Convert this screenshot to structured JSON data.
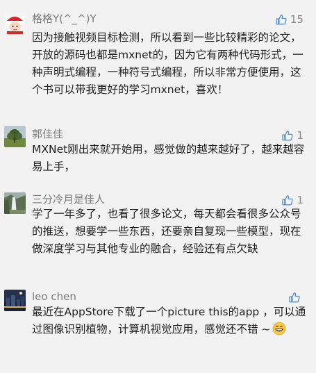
{
  "comments": [
    {
      "name": "格格Y(^_^)Y",
      "likes": "15",
      "avatar_icon": "christmas-girl-avatar",
      "text": "因为接触视频目标检测，所以看到一些比较精彩的论文，开放的源码也都是mxnet的，因为它有两种代码形式，一种声明式编程，一种符号式编程，所以非常方便使用，这个书可以带我更好的学习mxnet，喜欢！"
    },
    {
      "name": "郭佳佳",
      "likes": "1",
      "avatar_icon": "tree-landscape-avatar",
      "text": "MXNet刚出来就开始用，感觉做的越来越好了，越来越容易上手，"
    },
    {
      "name": "三分冷月是佳人",
      "likes": "1",
      "avatar_icon": "waterfall-landscape-avatar",
      "text": "学了一年多了，也看了很多论文，每天都会看很多公众号的推送，想要学一些东西，还要亲自复现一些模型，现在做深度学习与其他专业的融合，经验还有点欠缺"
    },
    {
      "name": "leo chen",
      "likes": "",
      "avatar_icon": "city-night-avatar",
      "text": "最近在AppStore下载了一个picture this的app ，可以通过图像识别植物，计算机视觉应用，感觉还不错 ~",
      "emoji": "grinning-emoji"
    }
  ],
  "colors": {
    "like_icon": "#5b8fcb",
    "name": "#7a7a7a",
    "text": "#1f1f1f",
    "background": "#f2f2f2"
  }
}
